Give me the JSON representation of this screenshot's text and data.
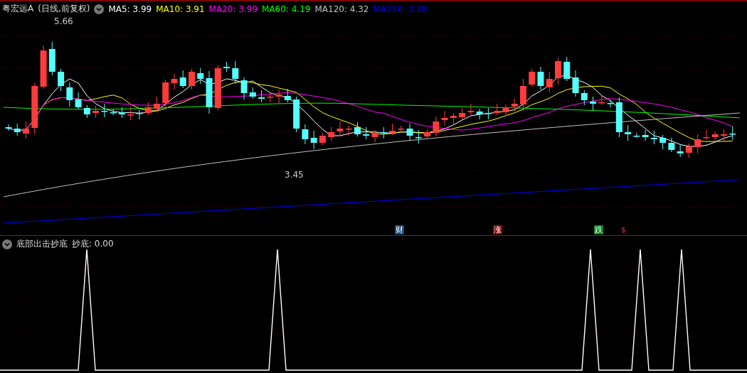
{
  "price_panel": {
    "title": "粤宏远A",
    "period": "(日线,前复权)",
    "moving_averages": [
      {
        "label": "MA5: 3.99",
        "color": "#ffffff"
      },
      {
        "label": "MA10: 3.91",
        "color": "#ffff00"
      },
      {
        "label": "MA20: 3.99",
        "color": "#ff00ff"
      },
      {
        "label": "MA60: 4.19",
        "color": "#00ff00"
      },
      {
        "label": "MA120: 4.32",
        "color": "#c0c0c0"
      },
      {
        "label": "MA250: 3.38",
        "color": "#0000ff"
      }
    ],
    "high_label": "5.66",
    "low_label": "3.45",
    "event_markers": [
      {
        "text": "财",
        "color": "#1a4a7a"
      },
      {
        "text": "涨",
        "color": "#8a0000"
      },
      {
        "text": "跌",
        "color": "#00801a"
      },
      {
        "text": "$",
        "color": "#000000"
      }
    ]
  },
  "indicator_panel": {
    "title": "底部出击抄底",
    "value_label": "抄底: 0.00"
  }
}
